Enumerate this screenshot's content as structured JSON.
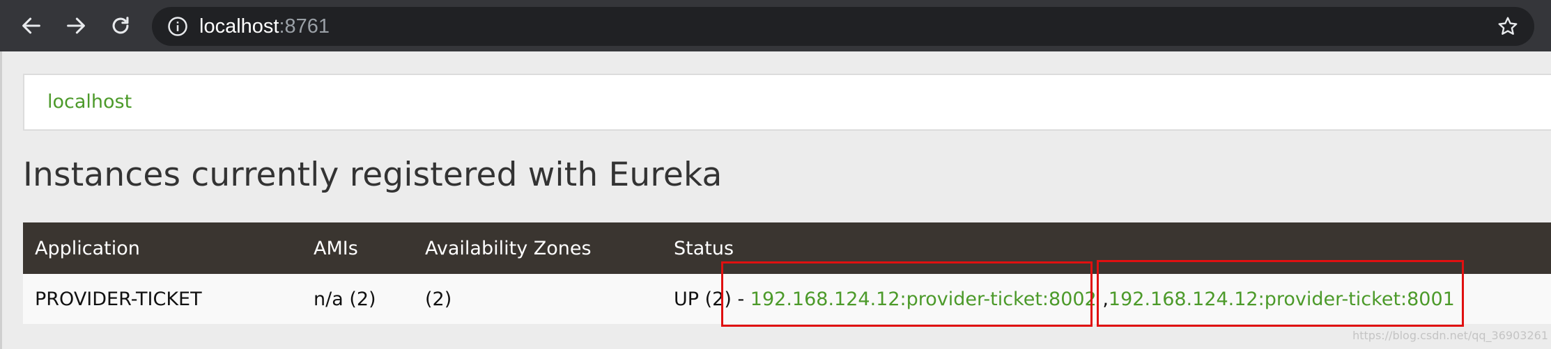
{
  "browser": {
    "url_host": "localhost",
    "url_port": ":8761",
    "icons": [
      "back-arrow-icon",
      "forward-arrow-icon",
      "reload-icon",
      "info-icon",
      "bookmark-star-icon"
    ]
  },
  "header": {
    "brand": "localhost"
  },
  "main": {
    "title": "Instances currently registered with Eureka",
    "table": {
      "columns": [
        "Application",
        "AMIs",
        "Availability Zones",
        "Status"
      ],
      "rows": [
        {
          "application": "PROVIDER-TICKET",
          "amis": "n/a (2)",
          "zones": "(2)",
          "status_prefix": "UP (2)",
          "status_sep": " - ",
          "instances": [
            "192.168.124.12:provider-ticket:8002",
            "192.168.124.12:provider-ticket:8001"
          ],
          "instance_sep": " ,"
        }
      ]
    }
  },
  "watermark": "https://blog.csdn.net/qq_36903261",
  "colors": {
    "link_green": "#4c9a2a",
    "table_header_bg": "#3a3530",
    "highlight_red": "#e01010",
    "chrome_bg": "#35363a"
  }
}
